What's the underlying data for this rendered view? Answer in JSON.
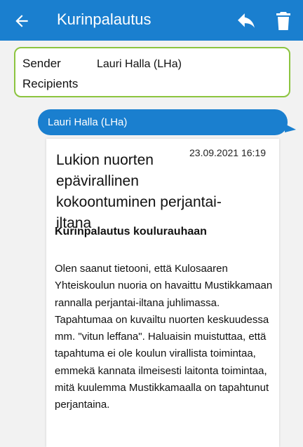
{
  "header": {
    "title": "Kurinpalautus",
    "back_icon": "arrow-left-icon",
    "reply_icon": "reply-icon",
    "delete_icon": "trash-icon",
    "color": "#1a7fcf"
  },
  "meta": {
    "sender_label": "Sender",
    "sender_value": "Lauri Halla (LHa)",
    "recipients_label": "Recipients",
    "border_color": "#8cc43f"
  },
  "message": {
    "sender_name": "Lauri Halla (LHa)",
    "subject": "Lukion nuorten epävirallinen kokoontuminen perjantai-iltana",
    "date": "23.09.2021 16:19",
    "heading": "Kurinpalautus koulurauhaan",
    "body": "Olen saanut tietooni, että Kulosaaren Yhteiskoulun nuoria on havaittu Mustikkamaan rannalla perjantai-iltana juhlimassa. Tapahtumaa on kuvailtu nuorten keskuudessa mm. \"vitun leffana\". Haluaisin muistuttaa, että tapahtuma ei ole koulun virallista toimintaa, emmekä kannata ilmeisesti laitonta toimintaa, mitä kuulemma Mustikkamaalla on tapahtunut perjantaina."
  }
}
